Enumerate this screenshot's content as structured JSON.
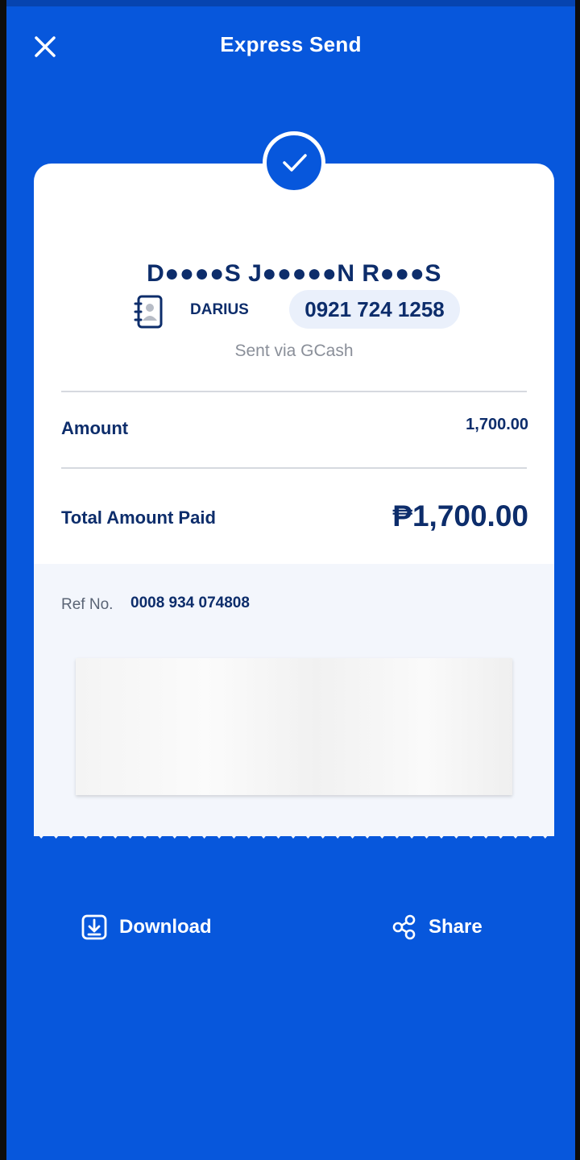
{
  "header": {
    "title": "Express Send",
    "close_icon": "close-icon"
  },
  "receipt": {
    "status_icon": "check-icon",
    "recipient_name": "D●●●●S J●●●●●N R●●●S",
    "contact_icon": "contact-book-icon",
    "contact_name": "DARIUS",
    "phone_number": "0921 724 1258",
    "sent_via": "Sent via GCash",
    "amount_label": "Amount",
    "amount_value": "1,700.00",
    "total_label": "Total Amount Paid",
    "total_value": "₱1,700.00",
    "ref_label": "Ref No.",
    "ref_value": "0008 934 074808"
  },
  "actions": {
    "download_label": "Download",
    "download_icon": "download-icon",
    "share_label": "Share",
    "share_icon": "share-icon"
  },
  "colors": {
    "brand_blue": "#0757dc",
    "text_navy": "#0d2d6b",
    "muted_gray": "#8a8f99"
  }
}
